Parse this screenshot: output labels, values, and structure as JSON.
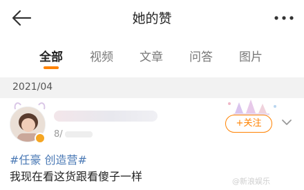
{
  "nav": {
    "title": "她的赞",
    "back_icon": "arrow-left-icon",
    "more_icon": "more-dots-icon"
  },
  "tabs": [
    {
      "label": "全部",
      "active": true
    },
    {
      "label": "视频",
      "active": false
    },
    {
      "label": "文章",
      "active": false
    },
    {
      "label": "问答",
      "active": false
    },
    {
      "label": "图片",
      "active": false
    }
  ],
  "section": {
    "date": "2021/04"
  },
  "post": {
    "time_prefix": "8/",
    "follow_label": "+关注",
    "topic": "#任豪 创造营#",
    "text": "我现在看这货跟看傻子一样",
    "dropdown_icon": "chevron-down-icon"
  },
  "watermark": "@新浪娱乐",
  "colors": {
    "accent": "#ff8200",
    "topic": "#4a79b5",
    "date_bar": "#f2f2f2"
  }
}
